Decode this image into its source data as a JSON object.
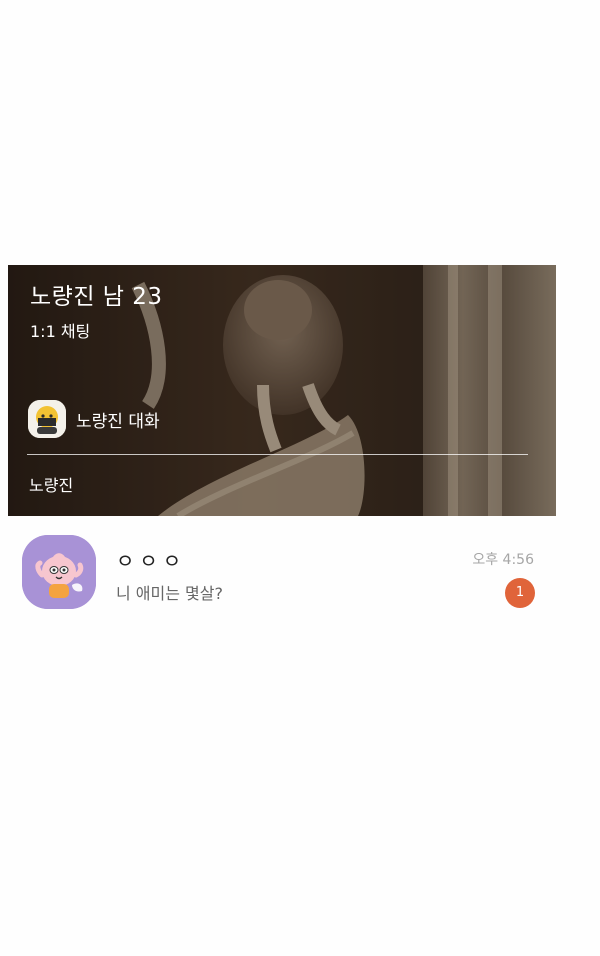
{
  "room": {
    "title": "노량진 남 23",
    "chat_type": "1:1 채팅",
    "conversation_label": "노량진 대화",
    "owner_name": "노량진",
    "background_image": "cat-on-cat-tower-photo",
    "avatar_icon": "profile-character-icon"
  },
  "chat_list": [
    {
      "name": "ㅇㅇㅇ",
      "preview": "니 애미는 몇살?",
      "time": "오후 4:56",
      "unread_count": "1",
      "avatar_icon": "peach-character-avatar"
    }
  ],
  "colors": {
    "badge": "#e0643a",
    "avatar_bg": "#a892d6",
    "time_text": "#a6a6a6",
    "preview_text": "#666666"
  }
}
